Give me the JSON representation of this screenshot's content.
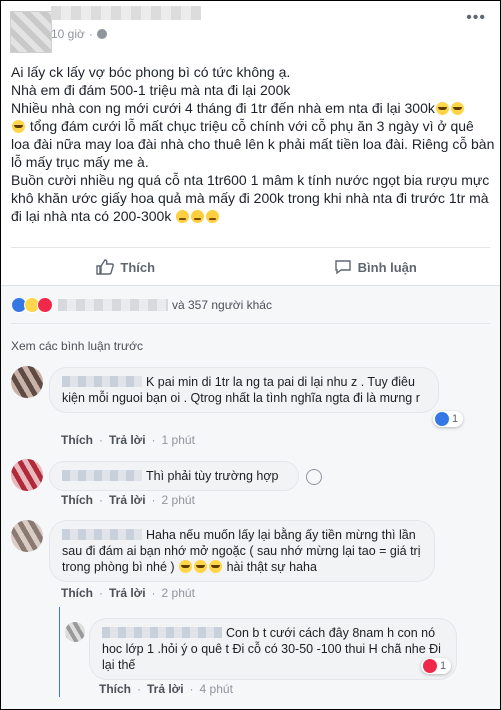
{
  "post": {
    "time": "10 giờ",
    "more_icon": "ellipsis-icon",
    "lines": [
      "Ai lấy ck lấy vợ bóc phong bì có tức không ạ.",
      "Nhà em đi đám 500-1 triệu mà nta đi lại 200k",
      "Nhiều nhà con ng mới cưới 4 tháng đi 1tr đến nhà em nta đi lại 300k",
      "tổng đám cưới lỗ mất chục triệu cỗ chính với cỗ phụ ăn 3 ngày vì ở quê loa đài nữa may loa đài nhà cho thuê lên k phải mất tiền loa đài. Riêng cỗ bàn lỗ mấy trục mấy me à.",
      "Buồn cười nhiều ng quá cỗ nta 1tr600 1 mâm k tính nước ngọt bia rượu mực khô khăn ước giấy hoa quả mà mấy đi 200k trong khi nhà nta đi trước 1tr mà đi lại nhà nta có 200-300k"
    ]
  },
  "actions": {
    "like": "Thích",
    "comment": "Bình luận"
  },
  "reactions": {
    "summary": "và 357 người khác",
    "colors": {
      "like": "#3578e5",
      "haha": "#ffd54a",
      "love": "#f0284a"
    }
  },
  "comments_section": {
    "view_more": "Xem các bình luận trước",
    "like_label": "Thích",
    "reply_label": "Trả lời",
    "items": [
      {
        "text": "K pai min di 1tr la ng ta pai di lại nhu z . Tuy điêu kiện mỗi nguoi bạn oi . Qtrog nhất la tình nghĩa ngta đi là mưng r",
        "time": "1 phút",
        "reaction_count": "1"
      },
      {
        "text": "Thì phải tùy trường hợp",
        "time": "2 phút"
      },
      {
        "text": "Haha nếu muốn lấy lại bằng ấy tiền mừng thì lần sau đi đám ai bạn nhớ mở ngoặc ( sau nhớ mừng lại tao = giá trị trong phòng bì nhé )",
        "text_tail": "hài thật sự haha",
        "time": "2 phút"
      },
      {
        "text": "Con b t cưới cách đây 8nam h con nó hoc lớp 1 .hỏi ý o quê t Đi cỗ có 30-50 -100 thui H chã nhe Đi lại thế",
        "time": "4 phút",
        "reaction_count": "1"
      }
    ]
  }
}
